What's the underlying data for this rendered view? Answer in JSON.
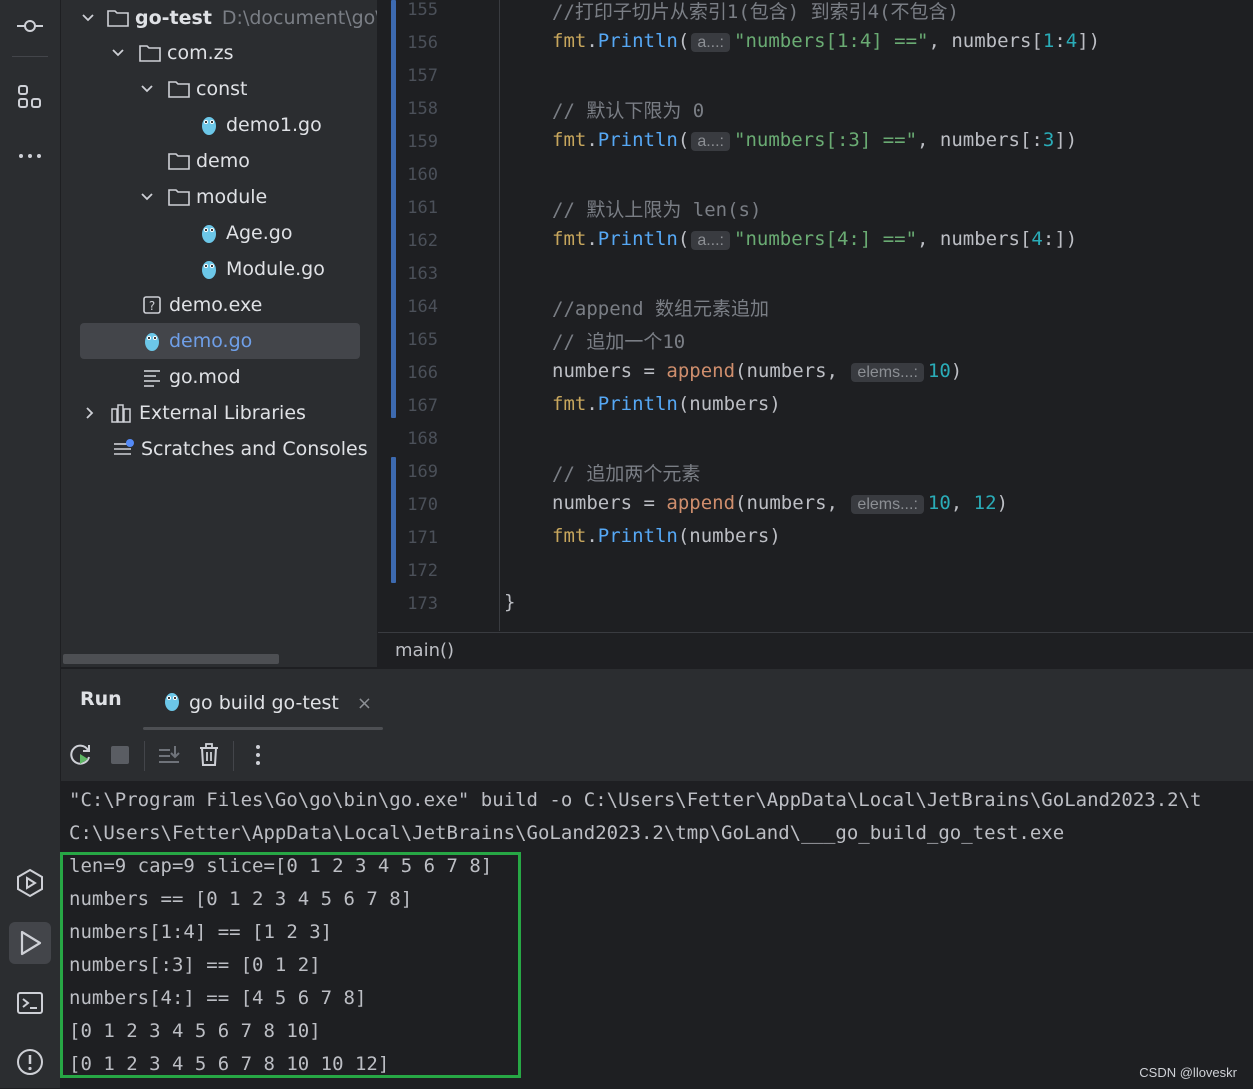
{
  "project": {
    "root_name": "go-test",
    "root_path": "D:\\document\\go\\",
    "items": [
      {
        "label": "com.zs"
      },
      {
        "label": "const"
      },
      {
        "label": "demo1.go"
      },
      {
        "label": "demo"
      },
      {
        "label": "module"
      },
      {
        "label": "Age.go"
      },
      {
        "label": "Module.go"
      },
      {
        "label": "demo.exe"
      },
      {
        "label": "demo.go"
      },
      {
        "label": "go.mod"
      },
      {
        "label": "External Libraries"
      },
      {
        "label": "Scratches and Consoles"
      }
    ]
  },
  "editor": {
    "line_numbers": [
      "155",
      "156",
      "157",
      "158",
      "159",
      "160",
      "161",
      "162",
      "163",
      "164",
      "165",
      "166",
      "167",
      "168",
      "169",
      "170",
      "171",
      "172",
      "173"
    ],
    "lines": {
      "l155": "//打印子切片从索引1(包含) 到索引4(不包含)",
      "l156_pkg": "fmt",
      "l156_fn": "Println",
      "l156_hint": "a...:",
      "l156_str": "\"numbers[1:4] ==\"",
      "l156_rest": ", numbers[",
      "l156_n1": "1",
      "l156_colon": ":",
      "l156_n2": "4",
      "l156_end": "])",
      "l158": "// 默认下限为 0",
      "l159_str": "\"numbers[:3] ==\"",
      "l159_rest": ", numbers[:",
      "l159_n": "3",
      "l161": "// 默认上限为 len(s)",
      "l162_str": "\"numbers[4:] ==\"",
      "l162_rest": ", numbers[",
      "l162_n": "4",
      "l162_end": ":])",
      "l164": "//append 数组元素追加",
      "l165": "// 追加一个10",
      "l166_a": "numbers = ",
      "l166_fn": "append",
      "l166_b": "(numbers, ",
      "l166_hint": "elems...:",
      "l166_n": "10",
      "l167_rest": "(numbers)",
      "l169": "// 追加两个元素",
      "l170_n1": "10",
      "l170_comma": ", ",
      "l170_n2": "12",
      "l173": "}",
      "open_paren": "(",
      "close_paren": ")",
      "dot": "."
    }
  },
  "breadcrumb": "main()",
  "run": {
    "panel_title": "Run",
    "tab_label": "go build go-test",
    "tab_close": "×",
    "console": [
      "\"C:\\Program Files\\Go\\go\\bin\\go.exe\" build -o C:\\Users\\Fetter\\AppData\\Local\\JetBrains\\GoLand2023.2\\t",
      "C:\\Users\\Fetter\\AppData\\Local\\JetBrains\\GoLand2023.2\\tmp\\GoLand\\___go_build_go_test.exe",
      "len=9 cap=9 slice=[0 1 2 3 4 5 6 7 8]",
      "numbers == [0 1 2 3 4 5 6 7 8]",
      "numbers[1:4] == [1 2 3]",
      "numbers[:3] == [0 1 2]",
      "numbers[4:] == [4 5 6 7 8]",
      "[0 1 2 3 4 5 6 7 8 10]",
      "[0 1 2 3 4 5 6 7 8 10 10 12]"
    ]
  },
  "watermark": "CSDN @lloveskr",
  "icons": {
    "activity": [
      "commit-icon",
      "structure-icon",
      "more-icon",
      "services-icon",
      "run-icon",
      "terminal-icon",
      "problems-icon"
    ],
    "toolbar": [
      "rerun-icon",
      "stop-icon",
      "scroll-to-end-icon",
      "clear-icon",
      "more-vertical-icon"
    ]
  },
  "colors": {
    "accent": "#3d6ab0",
    "highlight_box": "#27a745",
    "selection": "#43454a"
  }
}
